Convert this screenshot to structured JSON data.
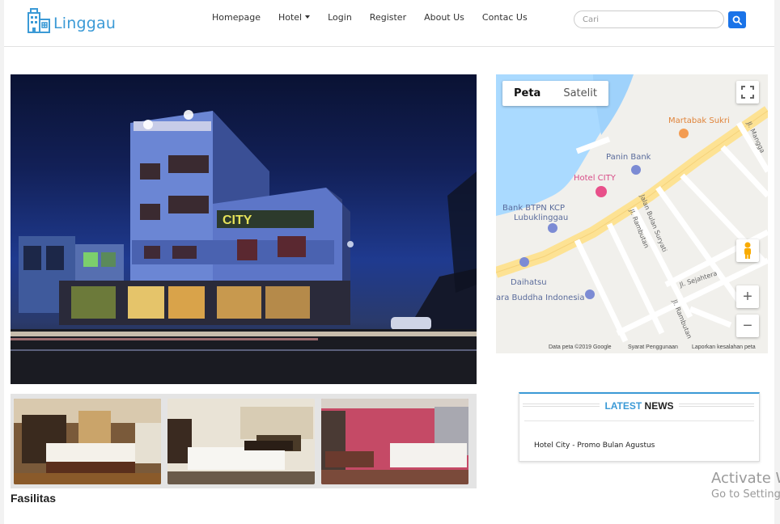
{
  "brand": {
    "name": "Linggau",
    "icon": "building-icon"
  },
  "nav": {
    "items": [
      {
        "label": "Homepage"
      },
      {
        "label": "Hotel"
      },
      {
        "label": "Login"
      },
      {
        "label": "Register"
      },
      {
        "label": "About Us"
      },
      {
        "label": "Contac Us"
      }
    ]
  },
  "search": {
    "placeholder": "Cari",
    "value": "",
    "button_icon": "search-icon",
    "accent": "#1a73e8"
  },
  "hero": {
    "sign_text": "CITY"
  },
  "section": {
    "fasilitas": "Fasilitas"
  },
  "map": {
    "tabs": [
      "Peta",
      "Satelit"
    ],
    "labels": {
      "martabak": "Martabak Sukri",
      "panin": "Panin Bank",
      "hotel": "Hotel CITY",
      "btpn1": "Bank BTPN KCP",
      "btpn2": "Lubuklinggau",
      "daihatsu": "Daihatsu",
      "vihara": "ara Buddha Indonesia",
      "bulan": "Jalan Bulan Suryati",
      "rambutan1": "Jl. Rambutan",
      "rambutan2": "Jl. Rambutan",
      "sejahtera": "Jl. Sejahtera",
      "mangga": "Jl. Mangga"
    },
    "footer": {
      "google": "Google",
      "data": "Data peta ©2019 Google",
      "terms": "Syarat Penggunaan",
      "report": "Laporkan kesalahan peta"
    },
    "controls": {
      "zoom_in": "+",
      "zoom_out": "−"
    }
  },
  "news": {
    "title_highlight": "LATEST",
    "title_rest": " NEWS",
    "items": [
      "Hotel City - Promo Bulan Agustus"
    ],
    "accent": "#3b9ad6"
  },
  "watermark": {
    "line1": "Activate W",
    "line2": "Go to Setting"
  }
}
